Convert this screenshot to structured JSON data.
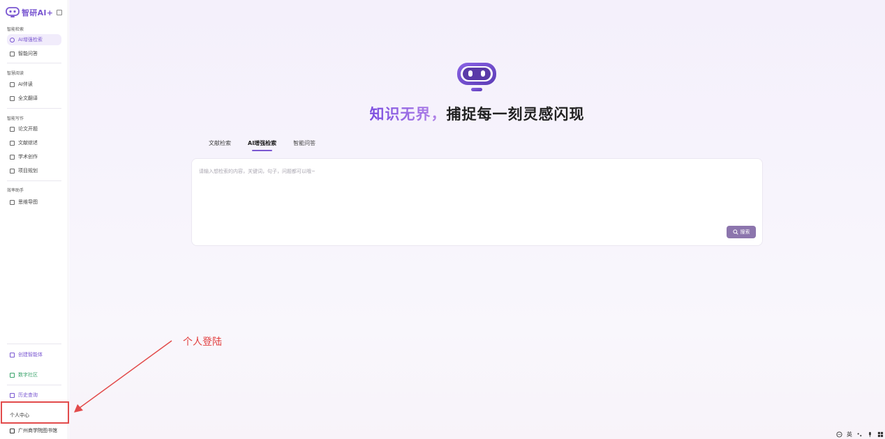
{
  "app": {
    "logo_text": "智研AI+"
  },
  "sidebar": {
    "sections": [
      {
        "title": "智能检索",
        "items": [
          {
            "label": "AI增强检索",
            "active": true
          },
          {
            "label": "智能问答",
            "active": false
          }
        ]
      },
      {
        "title": "智慧阅读",
        "items": [
          {
            "label": "AI伴读",
            "active": false
          },
          {
            "label": "全文翻译",
            "active": false
          }
        ]
      },
      {
        "title": "智能写作",
        "items": [
          {
            "label": "论文开题",
            "active": false
          },
          {
            "label": "文献综述",
            "active": false
          },
          {
            "label": "学术创作",
            "active": false
          },
          {
            "label": "项目规划",
            "active": false
          }
        ]
      },
      {
        "title": "效率助手",
        "items": [
          {
            "label": "思维导图",
            "active": false
          }
        ]
      }
    ],
    "bottom": {
      "create_agent": "创建智能体",
      "community": "数字社区",
      "history": "历史查询",
      "personal_center": "个人中心",
      "library": "广州商学院图书馆"
    }
  },
  "main": {
    "headline_accent": "知识无界，",
    "headline_rest": "捕捉每一刻灵感闪现",
    "tabs": [
      {
        "label": "文献检索",
        "active": false
      },
      {
        "label": "AI增强检索",
        "active": true
      },
      {
        "label": "智能问答",
        "active": false
      }
    ],
    "search_placeholder": "请输入想检索的内容，关键词，句子，问题都可以哦~",
    "search_button": "搜索"
  },
  "annotation": {
    "label": "个人登陆",
    "color": "#e23e3e"
  },
  "taskbar": {
    "ime_label": "英"
  },
  "colors": {
    "accent": "#7a57d1",
    "button": "#8c75ad",
    "community_green": "#3aa36b",
    "annotation_red": "#e24b4b"
  }
}
